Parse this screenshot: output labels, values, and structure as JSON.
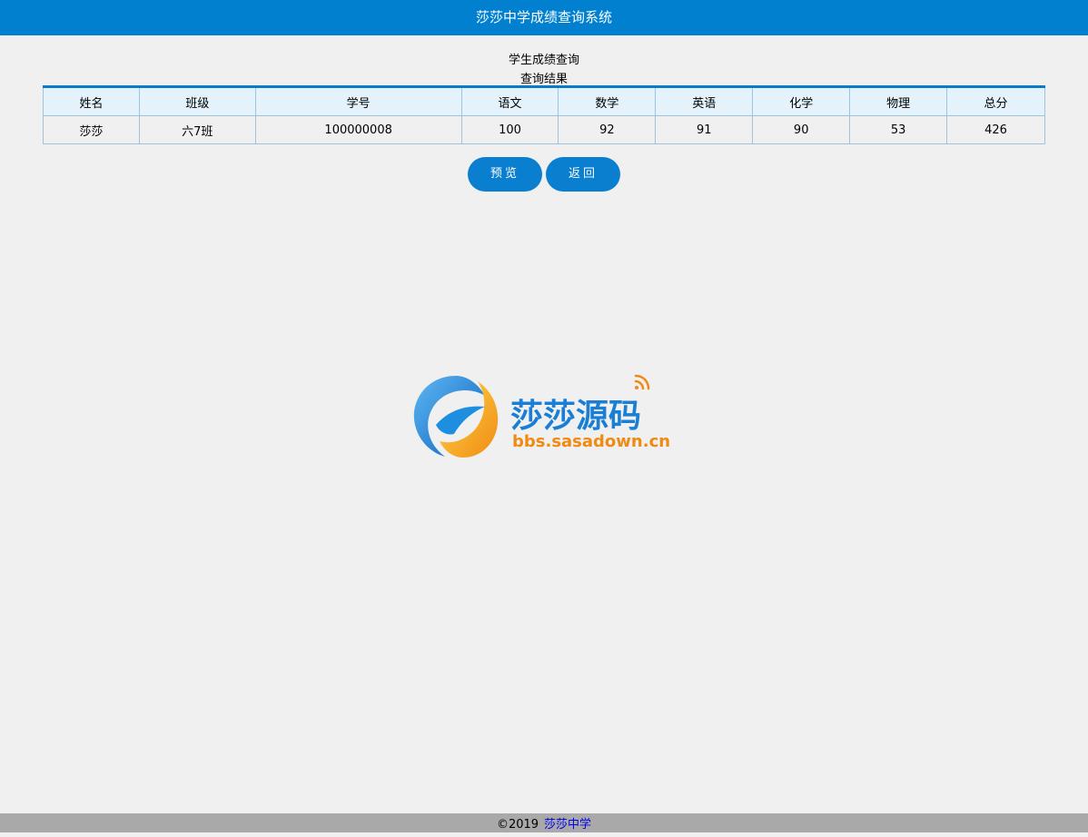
{
  "header": {
    "title": "莎莎中学成绩查询系统"
  },
  "page": {
    "subtitle": "学生成绩查询",
    "result_title": "查询结果"
  },
  "table": {
    "headers": [
      "姓名",
      "班级",
      "学号",
      "语文",
      "数学",
      "英语",
      "化学",
      "物理",
      "总分"
    ],
    "rows": [
      [
        "莎莎",
        "六7班",
        "100000008",
        "100",
        "92",
        "91",
        "90",
        "53",
        "426"
      ]
    ]
  },
  "buttons": {
    "preview": "预览",
    "back": "返回"
  },
  "logo": {
    "cn_text": "莎莎源码",
    "url_text": "bbs.sasadown.cn"
  },
  "footer": {
    "copyright": "©2019",
    "link": "莎莎中学"
  },
  "colors": {
    "primary": "#0080cf",
    "accent_orange": "#f5a623"
  }
}
